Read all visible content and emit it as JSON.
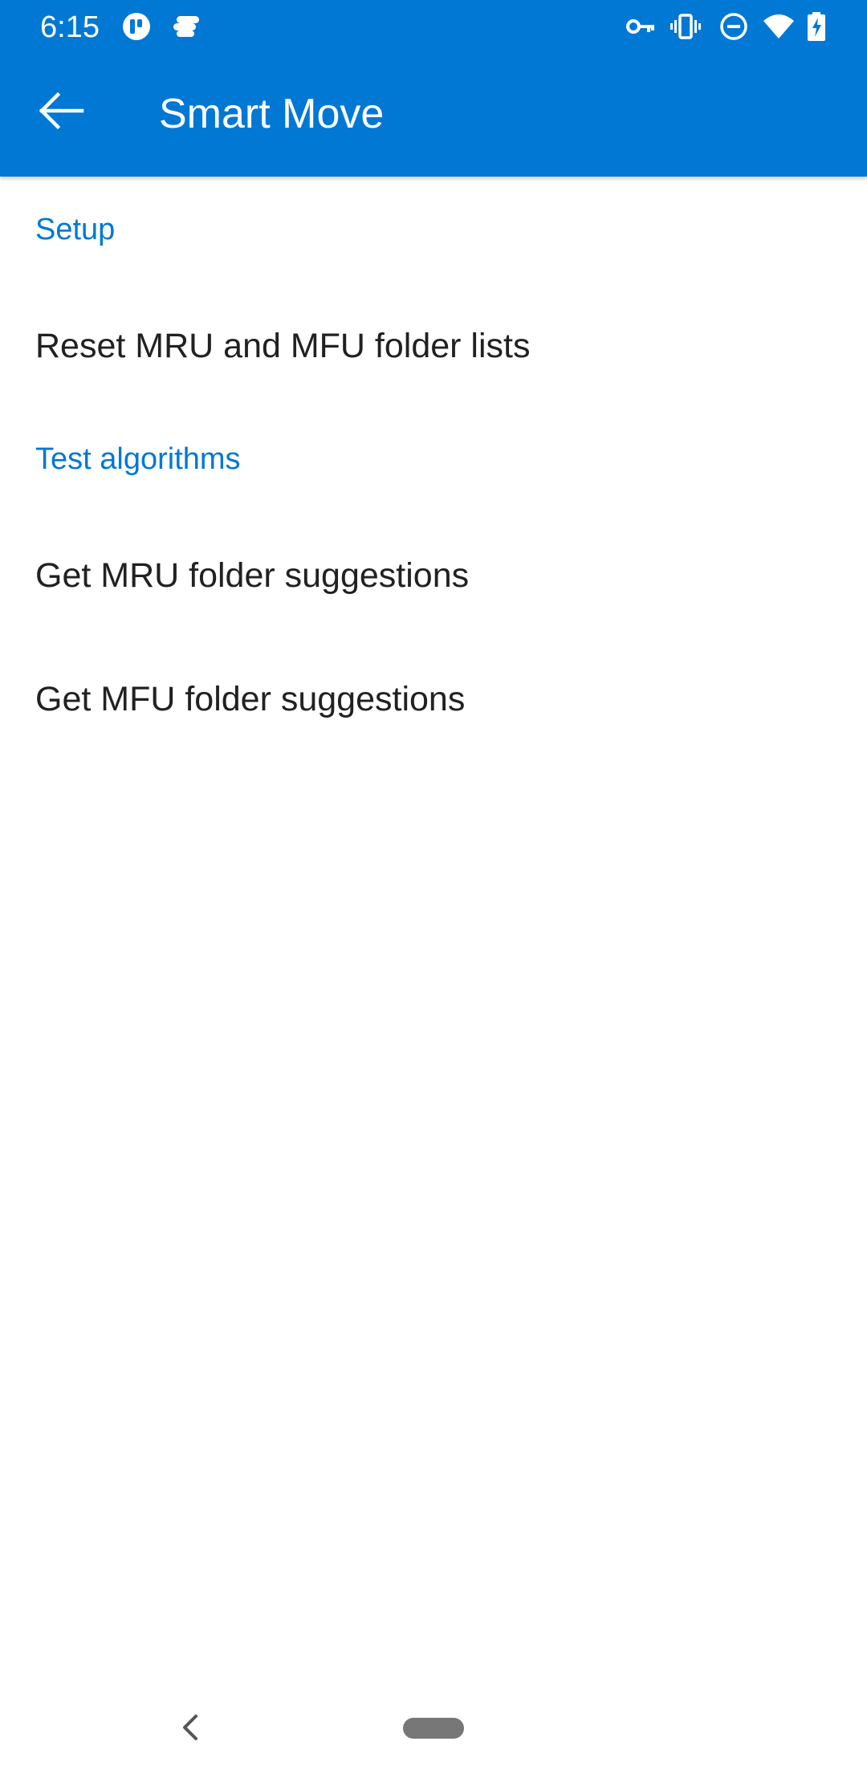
{
  "status_bar": {
    "time": "6:15",
    "left_icons": [
      "tasks-app-icon",
      "stack-app-icon"
    ],
    "right_icons": [
      "vpn-key-icon",
      "vibrate-icon",
      "do-not-disturb-icon",
      "wifi-icon",
      "battery-charging-icon"
    ]
  },
  "app_bar": {
    "title": "Smart Move",
    "back_icon": "arrow-left-icon"
  },
  "sections": [
    {
      "header": "Setup",
      "items": [
        {
          "label": "Reset MRU and MFU folder lists"
        }
      ]
    },
    {
      "header": "Test algorithms",
      "items": [
        {
          "label": "Get MRU folder suggestions"
        },
        {
          "label": "Get MFU folder suggestions"
        }
      ]
    }
  ],
  "nav_bar": {
    "back_icon": "chevron-left-icon",
    "home_icon": "home-pill-icon"
  },
  "colors": {
    "accent": "#0078d4",
    "text_primary": "#212121",
    "background": "#ffffff"
  }
}
